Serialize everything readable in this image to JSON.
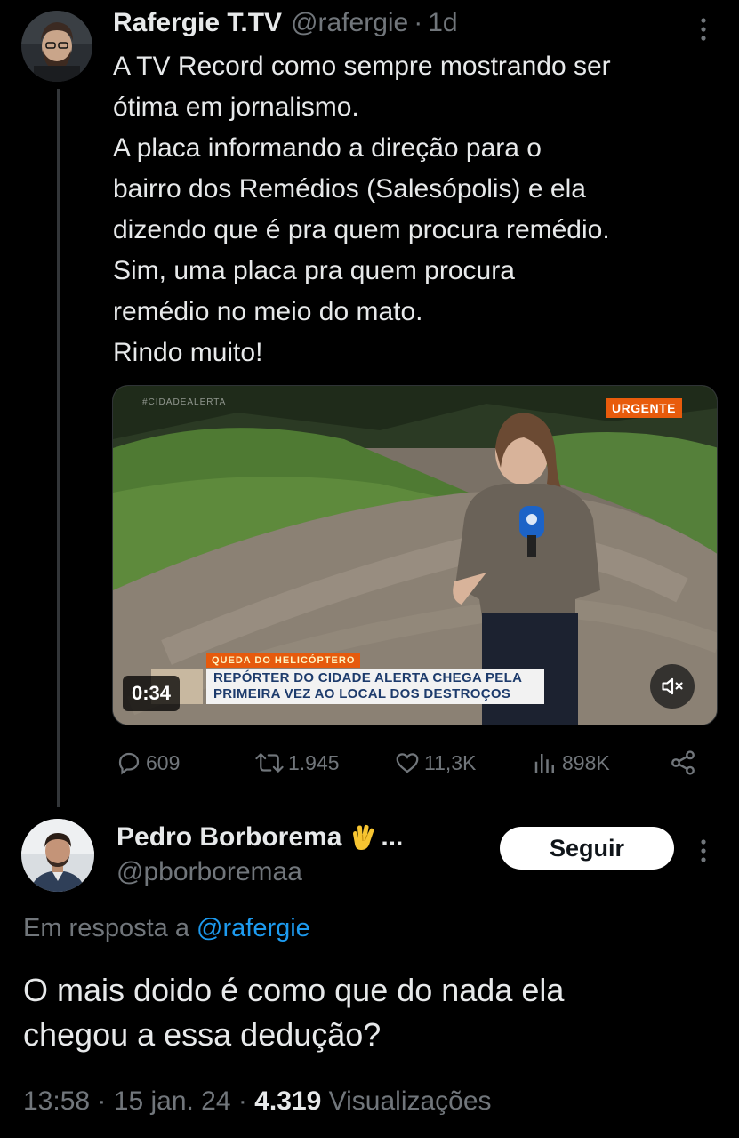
{
  "tweet": {
    "author_name": "Rafergie T.TV",
    "author_handle": "@rafergie",
    "separator": "·",
    "time_ago": "1d",
    "text_lines": [
      "A TV Record como sempre mostrando ser",
      "ótima em jornalismo.",
      "A placa informando a direção para o",
      "bairro dos Remédios (Salesópolis) e ela",
      "dizendo que é pra quem procura remédio.",
      "Sim, uma placa pra quem procura",
      "remédio no meio do mato.",
      "Rindo muito!"
    ],
    "video": {
      "badge": "URGENTE",
      "tag": "QUEDA DO HELICÓPTERO",
      "headline_line1": "REPÓRTER DO CIDADE ALERTA CHEGA PELA",
      "headline_line2": "PRIMEIRA VEZ AO LOCAL DOS DESTROÇOS",
      "duration": "0:34",
      "watermark": "#CIDADEALERTA"
    },
    "stats": {
      "replies": "609",
      "retweets": "1.945",
      "likes": "11,3K",
      "views": "898K"
    }
  },
  "reply": {
    "author_name": "Pedro Borborema",
    "name_suffix": "...",
    "author_handle": "@pborboremaa",
    "follow_label": "Seguir",
    "reply_prefix": "Em resposta a",
    "reply_mention": "@rafergie",
    "text_lines": [
      "O mais doido é como que do nada ela",
      "chegou a essa dedução?"
    ],
    "time": "13:58",
    "date": "15 jan. 24",
    "views_count": "4.319",
    "views_label": "Visualizações",
    "separator": "·"
  },
  "colors": {
    "background": "#000000",
    "text": "#e7e9ea",
    "muted": "#71767b",
    "link": "#1d9bf0",
    "urgent": "#e85b0c"
  }
}
